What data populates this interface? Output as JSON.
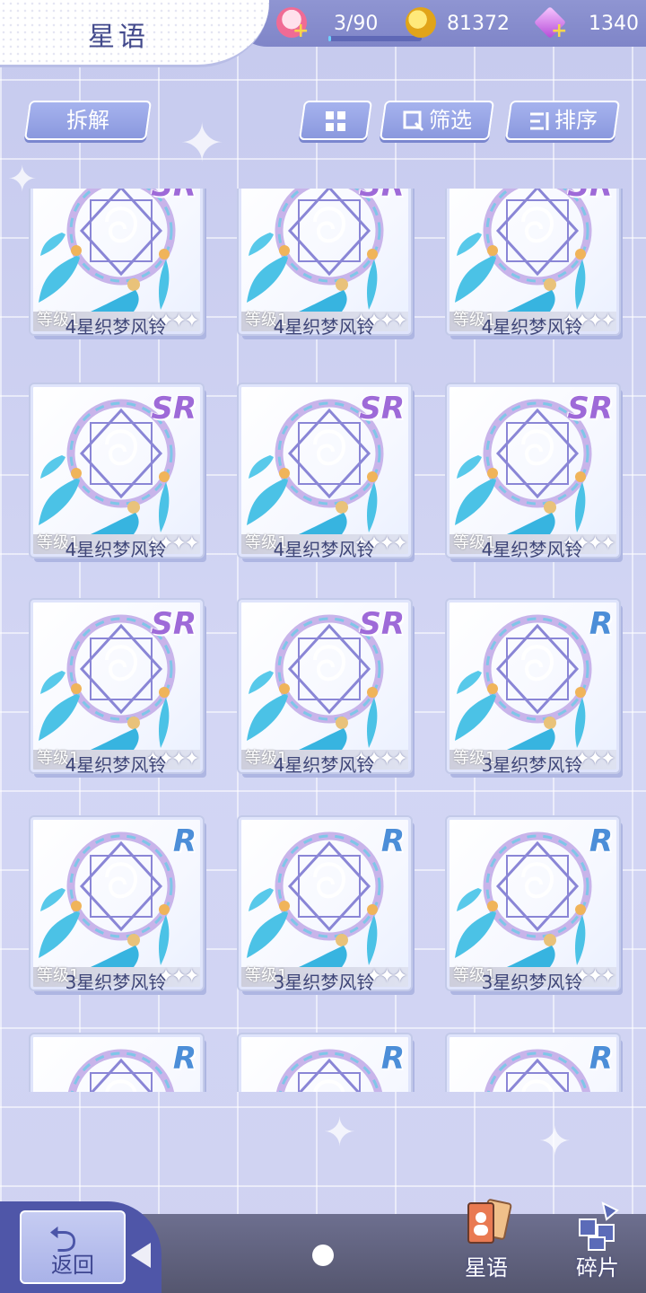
{
  "header": {
    "title": "星语",
    "stamina": {
      "value": "3/90",
      "fill": 0.033,
      "icon": "cake-icon"
    },
    "coins": {
      "value": "81372",
      "icon": "gold-coin-icon"
    },
    "diamonds": {
      "value": "1340",
      "icon": "crystal-icon"
    }
  },
  "toolbar": {
    "disassemble_label": "拆解",
    "grid_view_icon": "grid-view-icon",
    "filter_label": "筛选",
    "sort_label": "排序"
  },
  "items": [
    {
      "name": "4星织梦风铃",
      "level": "等级1",
      "stars": 4,
      "rarity": "SR"
    },
    {
      "name": "4星织梦风铃",
      "level": "等级1",
      "stars": 4,
      "rarity": "SR"
    },
    {
      "name": "4星织梦风铃",
      "level": "等级1",
      "stars": 4,
      "rarity": "SR"
    },
    {
      "name": "4星织梦风铃",
      "level": "等级1",
      "stars": 4,
      "rarity": "SR"
    },
    {
      "name": "4星织梦风铃",
      "level": "等级1",
      "stars": 4,
      "rarity": "SR"
    },
    {
      "name": "4星织梦风铃",
      "level": "等级1",
      "stars": 4,
      "rarity": "SR"
    },
    {
      "name": "4星织梦风铃",
      "level": "等级1",
      "stars": 4,
      "rarity": "SR"
    },
    {
      "name": "4星织梦风铃",
      "level": "等级1",
      "stars": 4,
      "rarity": "SR"
    },
    {
      "name": "3星织梦风铃",
      "level": "等级1",
      "stars": 3,
      "rarity": "R"
    },
    {
      "name": "3星织梦风铃",
      "level": "等级1",
      "stars": 3,
      "rarity": "R"
    },
    {
      "name": "3星织梦风铃",
      "level": "等级1",
      "stars": 3,
      "rarity": "R"
    },
    {
      "name": "3星织梦风铃",
      "level": "等级1",
      "stars": 3,
      "rarity": "R"
    },
    {
      "name": "",
      "level": "",
      "stars": 0,
      "rarity": "R"
    },
    {
      "name": "",
      "level": "",
      "stars": 0,
      "rarity": "R"
    },
    {
      "name": "",
      "level": "",
      "stars": 0,
      "rarity": "R"
    }
  ],
  "bottom": {
    "back_label": "返回",
    "tab_xingyu_label": "星语",
    "tab_fragments_label": "碎片"
  },
  "colors": {
    "accent": "#4f56a8",
    "sr": "#9e6ad8",
    "r": "#4c8ed8"
  }
}
